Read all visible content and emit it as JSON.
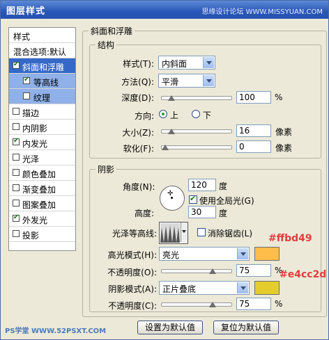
{
  "window": {
    "title": "图层样式",
    "watermark": "思缘设计论坛 WWW.MISSYUAN.COM"
  },
  "sidebar": {
    "header": "样式",
    "blend": "混合选项:默认",
    "items": [
      {
        "label": "斜面和浮雕",
        "checked": true
      },
      {
        "label": "等高线",
        "checked": true
      },
      {
        "label": "纹理",
        "checked": false
      },
      {
        "label": "描边",
        "checked": false
      },
      {
        "label": "内阴影",
        "checked": false
      },
      {
        "label": "内发光",
        "checked": true
      },
      {
        "label": "光泽",
        "checked": false
      },
      {
        "label": "颜色叠加",
        "checked": false
      },
      {
        "label": "渐变叠加",
        "checked": false
      },
      {
        "label": "图案叠加",
        "checked": false
      },
      {
        "label": "外发光",
        "checked": true
      },
      {
        "label": "投影",
        "checked": false
      }
    ]
  },
  "bevel": {
    "title": "斜面和浮雕",
    "structure": {
      "title": "结构",
      "style_label": "样式(T):",
      "style_value": "内斜面",
      "method_label": "方法(Q):",
      "method_value": "平滑",
      "depth_label": "深度(D):",
      "depth_value": "100",
      "depth_unit": "%",
      "depth_pos": 0.1,
      "direction_label": "方向:",
      "dir_up": "上",
      "dir_down": "下",
      "size_label": "大小(Z):",
      "size_value": "16",
      "size_unit": "像素",
      "size_pos": 0.1,
      "soften_label": "软化(F):",
      "soften_value": "0",
      "soften_unit": "像素",
      "soften_pos": 0.0
    },
    "shading": {
      "title": "阴影",
      "angle_label": "角度(N):",
      "angle_value": "120",
      "angle_unit": "度",
      "global_light_label": "使用全局光(G)",
      "altitude_label": "高度:",
      "altitude_value": "30",
      "altitude_unit": "度",
      "gloss_label": "光泽等高线:",
      "antialias_label": "消除锯齿(L)",
      "highlight_label": "高光模式(H):",
      "highlight_mode": "亮光",
      "highlight_color": "#ffbd49",
      "highlight_hex": "#ffbd49",
      "highlight_opacity_label": "不透明度(O):",
      "highlight_opacity": "75",
      "highlight_opacity_unit": "%",
      "highlight_opacity_pos": 0.75,
      "shadow_label": "阴影模式(A):",
      "shadow_mode": "正片叠底",
      "shadow_color": "#e4cc2d",
      "shadow_hex": "#e4cc2d",
      "shadow_opacity_label": "不透明度(C):",
      "shadow_opacity": "75",
      "shadow_opacity_unit": "%",
      "shadow_opacity_pos": 0.75
    }
  },
  "buttons": {
    "set_default": "设置为默认值",
    "reset_default": "复位为默认值"
  },
  "footer_watermark": "PS学堂 WWW.52PSXT.COM"
}
